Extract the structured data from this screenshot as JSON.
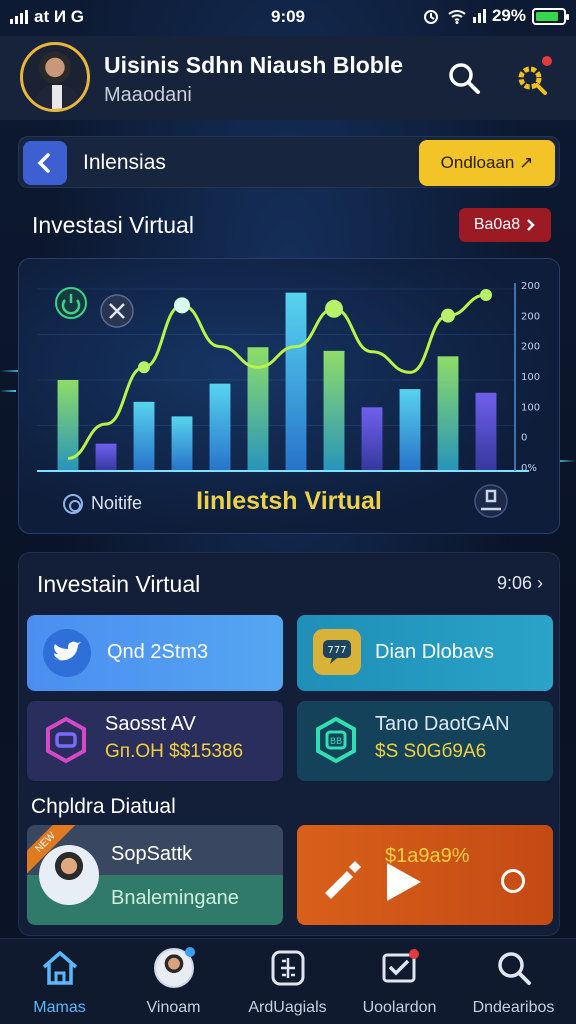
{
  "status_bar": {
    "carrier": "at И G",
    "time": "9:09",
    "battery_text": "2⁨9%",
    "battery_fraction": 0.85
  },
  "header": {
    "name": "Uisinis Sdhn Niaush Bloble",
    "subtitle": "Maaodani",
    "search_icon": "search-icon",
    "settings_icon": "gear-icon"
  },
  "nav": {
    "title": "Inlensias",
    "action_label": "Ondloaan ↗"
  },
  "section": {
    "title": "Investasi Virtual",
    "badge_label": "Ba0a8"
  },
  "chart_card": {
    "foot_left": "Noitife",
    "foot_title": "Iinlestsh Virtual"
  },
  "chart_data": {
    "type": "bar",
    "y_tick_labels": [
      "200",
      "200",
      "200",
      "100",
      "100",
      "0",
      "0%"
    ],
    "bars": [
      0.5,
      0.15,
      0.38,
      0.3,
      0.48,
      0.68,
      0.98,
      0.66,
      0.35,
      0.45,
      0.63,
      0.43
    ],
    "line": [
      0.05,
      0.25,
      0.58,
      0.94,
      0.7,
      0.58,
      0.7,
      0.92,
      0.67,
      0.55,
      0.88,
      1.0
    ],
    "colors": {
      "bar": "#39c8e8",
      "line": "#b8f24a",
      "accent": "#6a5ad8"
    }
  },
  "panel": {
    "title": "Investain Virtual",
    "meta": "9:06",
    "tiles": [
      {
        "label": "Qnd 2Stm3",
        "icon": "bird-icon"
      },
      {
        "label": "Dian Dlobavs",
        "icon": "chat-icon"
      },
      {
        "label": "Saosst AV",
        "label2": "Gп.ОН $$15386",
        "icon": "wallet-icon"
      },
      {
        "label": "Tano DaotGAN",
        "label2": "$S S0Gб9А6",
        "icon": "chip-icon"
      }
    ],
    "sub_title": "Chpldra Diatual",
    "promo_left": {
      "title": "SopSattk",
      "button": "Bnalemingane",
      "ribbon": "NEW"
    },
    "promo_right": {
      "price": "$1а9а9%",
      "icon": "play-icon"
    }
  },
  "tabs": [
    {
      "label": "Mamas",
      "icon": "home-icon",
      "active": true
    },
    {
      "label": "Vinoam",
      "icon": "profile-icon",
      "active": false
    },
    {
      "label": "ArdUagials",
      "icon": "calculator-icon",
      "active": false
    },
    {
      "label": "Uoolardon",
      "icon": "checklist-icon",
      "active": false
    },
    {
      "label": "Dndearibos",
      "icon": "search-icon",
      "active": false
    }
  ]
}
